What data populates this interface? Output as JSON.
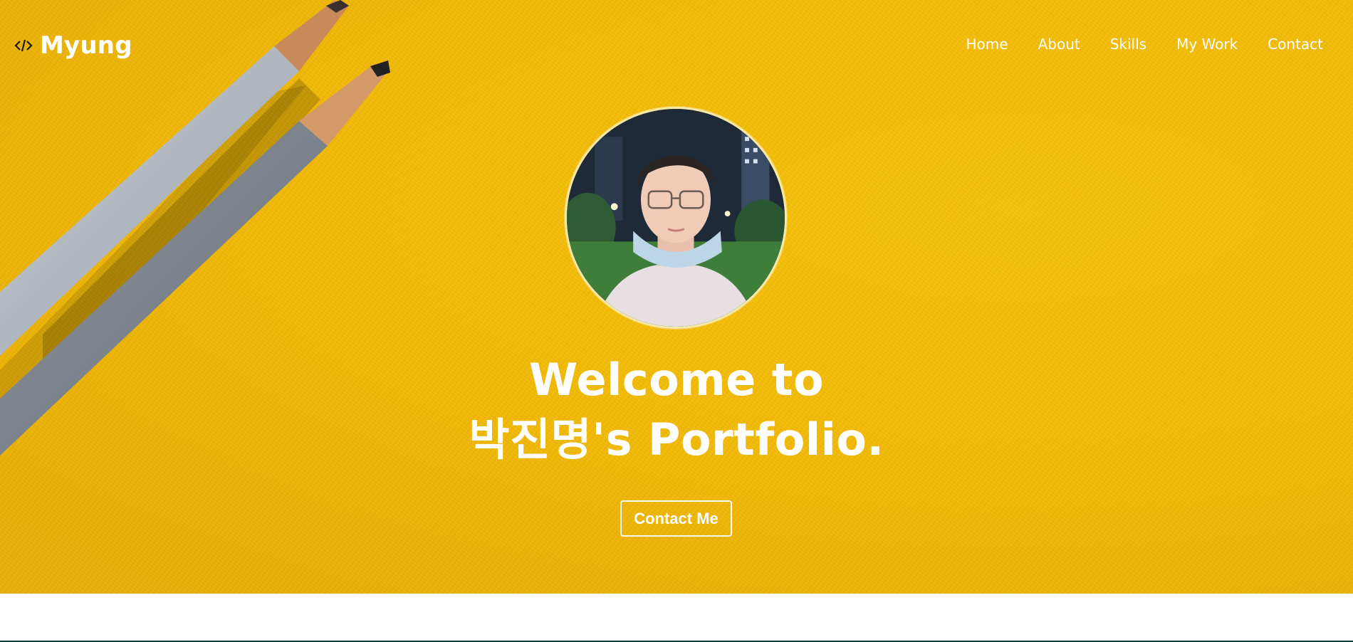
{
  "navbar": {
    "logo_icon": "code-icon",
    "logo_text": "Myung",
    "menu": [
      {
        "label": "Home"
      },
      {
        "label": "About"
      },
      {
        "label": "Skills"
      },
      {
        "label": "My Work"
      },
      {
        "label": "Contact"
      }
    ]
  },
  "home": {
    "title_line1": "Welcome to",
    "title_line2": "박진명's Portfolio.",
    "contact_button": "Contact Me"
  },
  "colors": {
    "hero_background": "#f5bd06",
    "text": "#ffffff",
    "profile_border": "#f6e9a8"
  }
}
